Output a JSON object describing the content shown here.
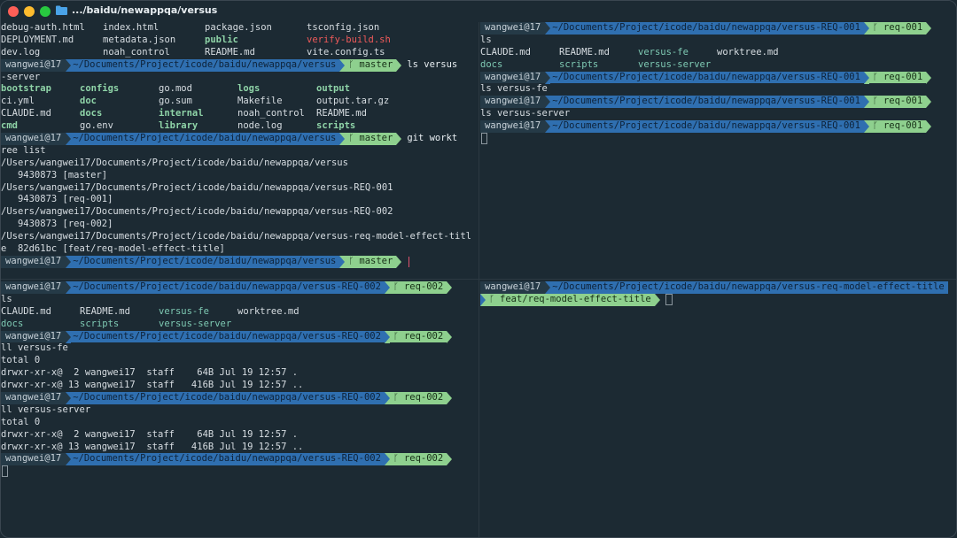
{
  "window": {
    "title": ".../baidu/newappqa/versus",
    "icon": "folder-icon",
    "colors": {
      "background": "#1c2a33",
      "path_segment": "#2f6fb0",
      "branch_segment": "#8ed08e",
      "user_segment": "#253a47",
      "exec_file": "#f05a5a",
      "dir": "#8fd4a8"
    }
  },
  "prompt_user": "wangwei@17",
  "paths": {
    "versus": "~/Documents/Project/icode/baidu/newappqa/versus",
    "req001": "~/Documents/Project/icode/baidu/newappqa/versus-REQ-001",
    "req002": "~/Documents/Project/icode/baidu/newappqa/versus-REQ-002",
    "model": "~/Documents/Project/icode/baidu/newappqa/versus-req-model-effect-title"
  },
  "branches": {
    "master": "master",
    "req001": "req-001",
    "req002": "req-002",
    "model": "feat/req-model-effect-title"
  },
  "tl": {
    "files_top": [
      [
        "debug-auth.html",
        "index.html",
        "package.json",
        "tsconfig.json"
      ],
      [
        "DEPLOYMENT.md",
        "metadata.json",
        "public",
        "verify-build.sh"
      ],
      [
        "dev.log",
        "noah_control",
        "README.md",
        "vite.config.ts"
      ]
    ],
    "cmd1": "ls versus",
    "cmd1_wrap": "-server",
    "files_mid": [
      [
        "bootstrap",
        "configs",
        "go.mod",
        "logs",
        "output"
      ],
      [
        "ci.yml",
        "doc",
        "go.sum",
        "Makefile",
        "output.tar.gz"
      ],
      [
        "CLAUDE.md",
        "docs",
        "internal",
        "noah_control",
        "README.md"
      ],
      [
        "cmd",
        "go.env",
        "library",
        "node.log",
        "scripts"
      ]
    ],
    "cmd2": "git workt",
    "cmd2_wrap": "ree list",
    "worktree_lines": [
      "/Users/wangwei17/Documents/Project/icode/baidu/newappqa/versus",
      "   9430873 [master]",
      "/Users/wangwei17/Documents/Project/icode/baidu/newappqa/versus-REQ-001",
      "   9430873 [req-001]",
      "/Users/wangwei17/Documents/Project/icode/baidu/newappqa/versus-REQ-002",
      "   9430873 [req-002]",
      "/Users/wangwei17/Documents/Project/icode/baidu/newappqa/versus-req-model-effect-titl",
      "e  82d61bc [feat/req-model-effect-title]"
    ]
  },
  "tr": {
    "cmd_ls": "ls",
    "files": [
      [
        "CLAUDE.md",
        "README.md",
        "versus-fe",
        "worktree.md"
      ],
      [
        "docs",
        "scripts",
        "versus-server",
        ""
      ]
    ],
    "cmd_fe": "ls versus-fe",
    "cmd_server": "ls versus-server"
  },
  "bl": {
    "cmd_ls": "ls",
    "files": [
      [
        "CLAUDE.md",
        "README.md",
        "versus-fe",
        "worktree.md"
      ],
      [
        "docs",
        "scripts",
        "versus-server",
        ""
      ]
    ],
    "cmd_fe": "ll versus-fe",
    "total": "total 0",
    "fe_rows": [
      "drwxr-xr-x@  2 wangwei17  staff    64B Jul 19 12:57 .",
      "drwxr-xr-x@ 13 wangwei17  staff   416B Jul 19 12:57 .."
    ],
    "cmd_server": "ll versus-server",
    "server_rows": [
      "drwxr-xr-x@  2 wangwei17  staff    64B Jul 19 12:57 .",
      "drwxr-xr-x@ 13 wangwei17  staff   416B Jul 19 12:57 .."
    ]
  }
}
